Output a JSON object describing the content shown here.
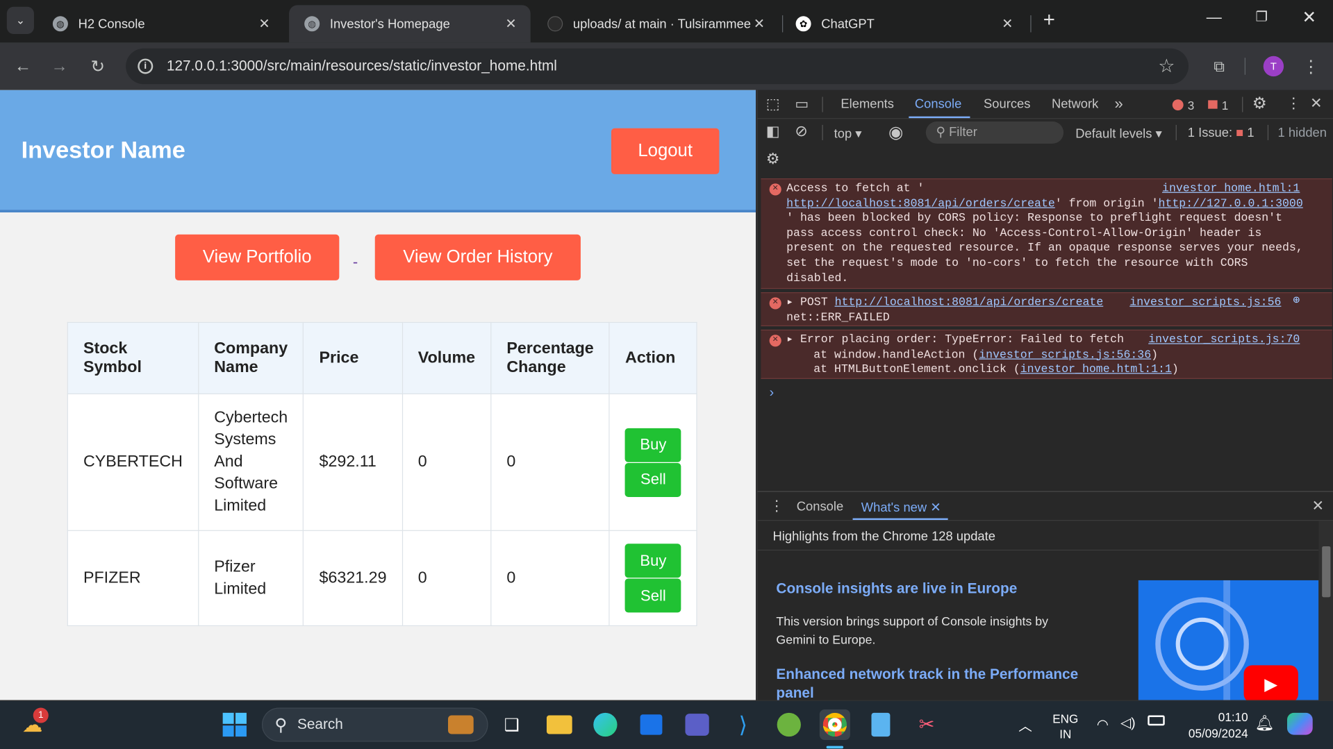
{
  "browser": {
    "tabs": [
      {
        "label": "H2 Console",
        "close": "✕"
      },
      {
        "label": "Investor's Homepage",
        "close": "✕"
      },
      {
        "label": "uploads/ at main · Tulsirammee",
        "close": "✕"
      },
      {
        "label": "ChatGPT",
        "close": "✕"
      }
    ],
    "new_tab": "+",
    "url": "127.0.0.1:3000/src/main/resources/static/investor_home.html",
    "profile_initial": "T"
  },
  "page": {
    "investor_name": "Investor Name",
    "logout": "Logout",
    "view_portfolio": "View Portfolio",
    "separator": "-",
    "view_order_history": "View Order History",
    "table": {
      "headers": [
        "Stock Symbol",
        "Company Name",
        "Price",
        "Volume",
        "Percentage Change",
        "Action"
      ],
      "rows": [
        {
          "symbol": "CYBERTECH",
          "company": "Cybertech Systems And Software Limited",
          "price": "$292.11",
          "volume": "0",
          "change": "0",
          "buy": "Buy",
          "sell": "Sell"
        },
        {
          "symbol": "PFIZER",
          "company": "Pfizer Limited",
          "price": "$6321.29",
          "volume": "0",
          "change": "0",
          "buy": "Buy",
          "sell": "Sell"
        }
      ]
    }
  },
  "devtools": {
    "tabs": [
      "Elements",
      "Console",
      "Sources",
      "Network"
    ],
    "error_count": "3",
    "issue_count": "1",
    "context": "top",
    "filter_placeholder": "Filter",
    "levels": "Default levels",
    "issues_label": "1 Issue:",
    "issues_num": "1",
    "hidden": "1 hidden",
    "messages": {
      "m1_source": "investor_home.html:1",
      "m1_lines": [
        "Access to fetch at '",
        "' from origin '",
        "' has been blocked by CORS policy: Response to preflight request doesn't",
        "pass access control check: No 'Access-Control-Allow-Origin' header is",
        "present on the requested resource. If an opaque response serves your needs,",
        "set the request's mode to 'no-cors' to fetch the resource with CORS",
        "disabled."
      ],
      "m1_url": "http://localhost:8081/api/orders/create",
      "m1_origin": "http://127.0.0.1:3000",
      "m2_method": "POST",
      "m2_url": "http://localhost:8081/api/orders/create",
      "m2_source": "investor_scripts.js:56",
      "m2_err": "net::ERR_FAILED",
      "m3_text": "Error placing order: TypeError: Failed to fetch",
      "m3_source": "investor_scripts.js:70",
      "m3_at1_pre": "at window.handleAction (",
      "m3_at1_link": "investor_scripts.js:56:36",
      "m3_at2_pre": "at HTMLButtonElement.onclick (",
      "m3_at2_link": "investor_home.html:1:1",
      "close_paren": ")"
    },
    "prompt": "›",
    "drawer": {
      "tabs": [
        "Console",
        "What's new"
      ],
      "highlight": "Highlights from the Chrome 128 update",
      "h1": "Console insights are live in Europe",
      "p1": "This version brings support of Console insights by Gemini to Europe.",
      "h2": "Enhanced network track in the Performance panel"
    }
  },
  "taskbar": {
    "search": "Search",
    "weather_badge": "1",
    "lang1": "ENG",
    "lang2": "IN",
    "time": "01:10",
    "date": "05/09/2024"
  }
}
